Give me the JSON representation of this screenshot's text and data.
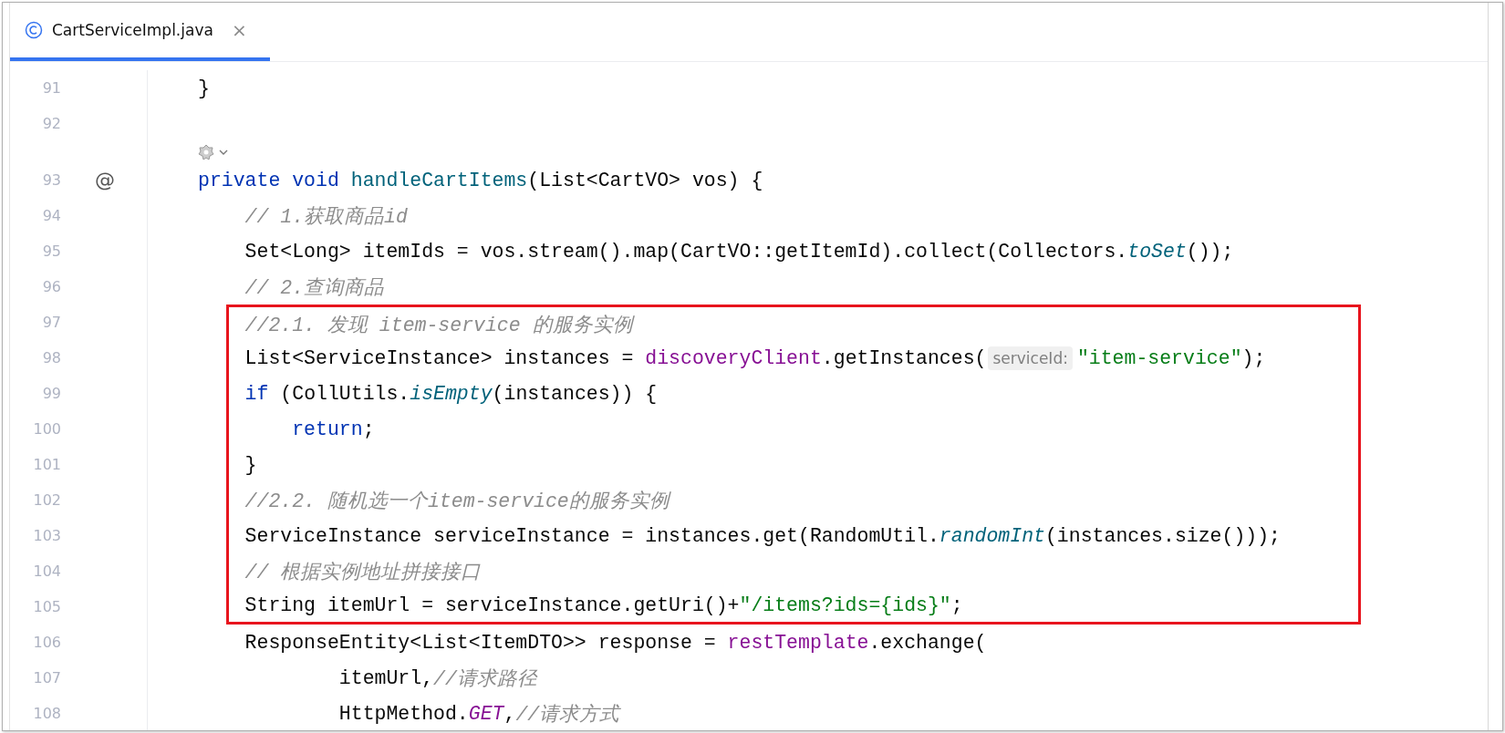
{
  "tabs": [
    {
      "label": "CartServiceImpl.java",
      "close": "×",
      "selected": true
    }
  ],
  "lines": [
    {
      "number": "91",
      "boxed": false,
      "tokens": [
        {
          "text": "}",
          "kind": "plain"
        }
      ]
    },
    {
      "number": "92",
      "boxed": false
    },
    {
      "number": "93",
      "boxed": false,
      "inlay": true,
      "gutter": "@",
      "tokens": [
        {
          "text": "private void ",
          "kind": "keyword"
        },
        {
          "text": "handleCartItems",
          "kind": "decl"
        },
        {
          "text": "(List<CartVO> vos) {",
          "kind": "plain"
        }
      ]
    },
    {
      "number": "94",
      "boxed": false,
      "tokens": [
        {
          "text": "    // 1.获取商品id",
          "kind": "comment"
        }
      ]
    },
    {
      "number": "95",
      "boxed": false,
      "tokens": [
        {
          "text": "    Set<Long> itemIds = vos.stream().map(CartVO::getItemId).collect(Collectors.",
          "kind": "plain"
        },
        {
          "text": "toSet",
          "kind": "static"
        },
        {
          "text": "());",
          "kind": "plain"
        }
      ]
    },
    {
      "number": "96",
      "boxed": false,
      "tokens": [
        {
          "text": "    // 2.查询商品",
          "kind": "comment"
        }
      ]
    },
    {
      "number": "97",
      "boxed": true,
      "tokens": [
        {
          "text": "    //2.1. 发现 item-service 的服务实例",
          "kind": "comment"
        }
      ]
    },
    {
      "number": "98",
      "boxed": true,
      "tokens": [
        {
          "text": "    List<ServiceInstance> instances = ",
          "kind": "plain"
        },
        {
          "text": "discoveryClient",
          "kind": "field"
        },
        {
          "text": ".getInstances(",
          "kind": "plain"
        },
        {
          "text": "serviceId:",
          "kind": "hint"
        },
        {
          "text": "\"item-service\"",
          "kind": "string"
        },
        {
          "text": ");",
          "kind": "plain"
        }
      ]
    },
    {
      "number": "99",
      "boxed": true,
      "tokens": [
        {
          "text": "    if ",
          "kind": "keyword"
        },
        {
          "text": "(CollUtils.",
          "kind": "plain"
        },
        {
          "text": "isEmpty",
          "kind": "static"
        },
        {
          "text": "(instances)) {",
          "kind": "plain"
        }
      ]
    },
    {
      "number": "100",
      "boxed": true,
      "tokens": [
        {
          "text": "        return",
          "kind": "keyword"
        },
        {
          "text": ";",
          "kind": "plain"
        }
      ]
    },
    {
      "number": "101",
      "boxed": true,
      "tokens": [
        {
          "text": "    }",
          "kind": "plain"
        }
      ]
    },
    {
      "number": "102",
      "boxed": true,
      "tokens": [
        {
          "text": "    //2.2. 随机选一个item-service的服务实例",
          "kind": "comment"
        }
      ]
    },
    {
      "number": "103",
      "boxed": true,
      "tokens": [
        {
          "text": "    ServiceInstance serviceInstance = instances.get(RandomUtil.",
          "kind": "plain"
        },
        {
          "text": "randomInt",
          "kind": "static"
        },
        {
          "text": "(instances.size()));",
          "kind": "plain"
        }
      ]
    },
    {
      "number": "104",
      "boxed": true,
      "tokens": [
        {
          "text": "    // 根据实例地址拼接接口",
          "kind": "comment"
        }
      ]
    },
    {
      "number": "105",
      "boxed": true,
      "tokens": [
        {
          "text": "    String itemUrl = serviceInstance.getUri()+",
          "kind": "plain"
        },
        {
          "text": "\"/items?ids={ids}\"",
          "kind": "string"
        },
        {
          "text": ";",
          "kind": "plain"
        }
      ]
    },
    {
      "number": "106",
      "boxed": false,
      "tokens": [
        {
          "text": "    ResponseEntity<List<ItemDTO>> response = ",
          "kind": "plain"
        },
        {
          "text": "restTemplate",
          "kind": "field"
        },
        {
          "text": ".exchange(",
          "kind": "plain"
        }
      ]
    },
    {
      "number": "107",
      "boxed": false,
      "tokens": [
        {
          "text": "            itemUrl,",
          "kind": "plain"
        },
        {
          "text": "//请求路径",
          "kind": "comment"
        }
      ]
    },
    {
      "number": "108",
      "boxed": false,
      "tokens": [
        {
          "text": "            HttpMethod.",
          "kind": "plain"
        },
        {
          "text": "GET",
          "kind": "constant"
        },
        {
          "text": ",",
          "kind": "plain"
        },
        {
          "text": "//请求方式",
          "kind": "comment"
        }
      ]
    }
  ]
}
